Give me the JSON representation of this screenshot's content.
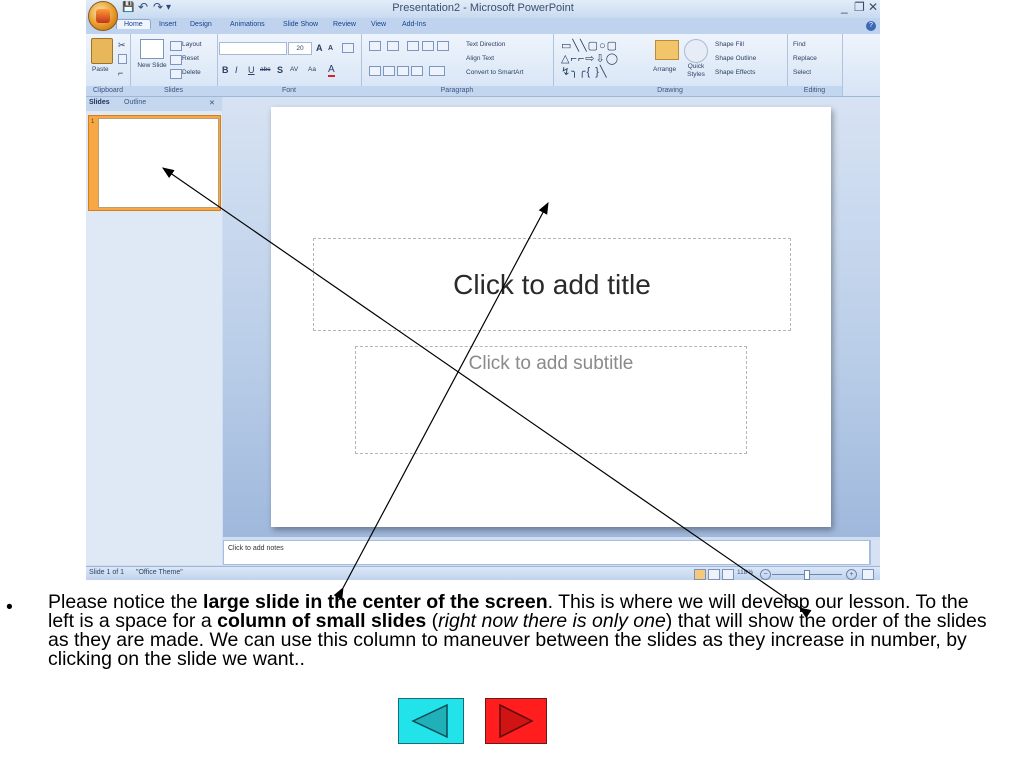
{
  "window": {
    "title": "Presentation2 - Microsoft PowerPoint",
    "controls": [
      "_",
      "❐",
      "✕"
    ]
  },
  "qat": {
    "save": "💾",
    "undo": "↶",
    "redo": "↷",
    "more": "▾"
  },
  "tabs": [
    "Home",
    "Insert",
    "Design",
    "Animations",
    "Slide Show",
    "Review",
    "View",
    "Add-Ins"
  ],
  "ribbon": {
    "clipboard": {
      "label": "Clipboard",
      "paste": "Paste"
    },
    "slides": {
      "label": "Slides",
      "new_slide": "New Slide",
      "layout": "Layout",
      "reset": "Reset",
      "delete": "Delete"
    },
    "font": {
      "label": "Font",
      "font_size": "20",
      "grow": "A",
      "shrink": "A",
      "bold": "B",
      "italic": "I",
      "underline": "U",
      "strike": "abc",
      "shadow": "S",
      "spacing": "AV",
      "case": "Aa",
      "color": "A"
    },
    "paragraph": {
      "label": "Paragraph",
      "text_direction": "Text Direction",
      "align_text": "Align Text",
      "convert_smartart": "Convert to SmartArt"
    },
    "drawing": {
      "label": "Drawing",
      "arrange": "Arrange",
      "quick_styles": "Quick Styles",
      "shape_fill": "Shape Fill",
      "shape_outline": "Shape Outline",
      "shape_effects": "Shape Effects"
    },
    "editing": {
      "label": "Editing",
      "find": "Find",
      "replace": "Replace",
      "select": "Select"
    }
  },
  "pane": {
    "tab_slides": "Slides",
    "tab_outline": "Outline",
    "close": "✕",
    "thumb_number": "1"
  },
  "slide": {
    "title_placeholder": "Click to add title",
    "subtitle_placeholder": "Click to add subtitle"
  },
  "notes": {
    "placeholder": "Click to add notes"
  },
  "status": {
    "slide_info": "Slide 1 of 1",
    "theme": "\"Office Theme\"",
    "zoom": "118%"
  },
  "body": {
    "bullet": "•",
    "p1": "Please notice the ",
    "b1": "large slide in the center of the screen",
    "p2": ".  This is where we will develop our lesson.  To the left is a space for a ",
    "b2": "column of small slides",
    "p3": " (",
    "i1": "right now there is only one",
    "p4": ") that will show the order of the slides as they are made.  We can use this column to maneuver between the slides as they increase in number, by clicking on the slide we want.."
  },
  "nav": {
    "back": "back-arrow-icon",
    "forward": "forward-arrow-icon"
  },
  "colors": {
    "ribbon_bg": "#d6e4f5",
    "slide_area": "#b9cde8",
    "thumb_highlight": "#f7a845",
    "nav_back": "#22e3ea",
    "nav_forward": "#ff1d1d"
  }
}
